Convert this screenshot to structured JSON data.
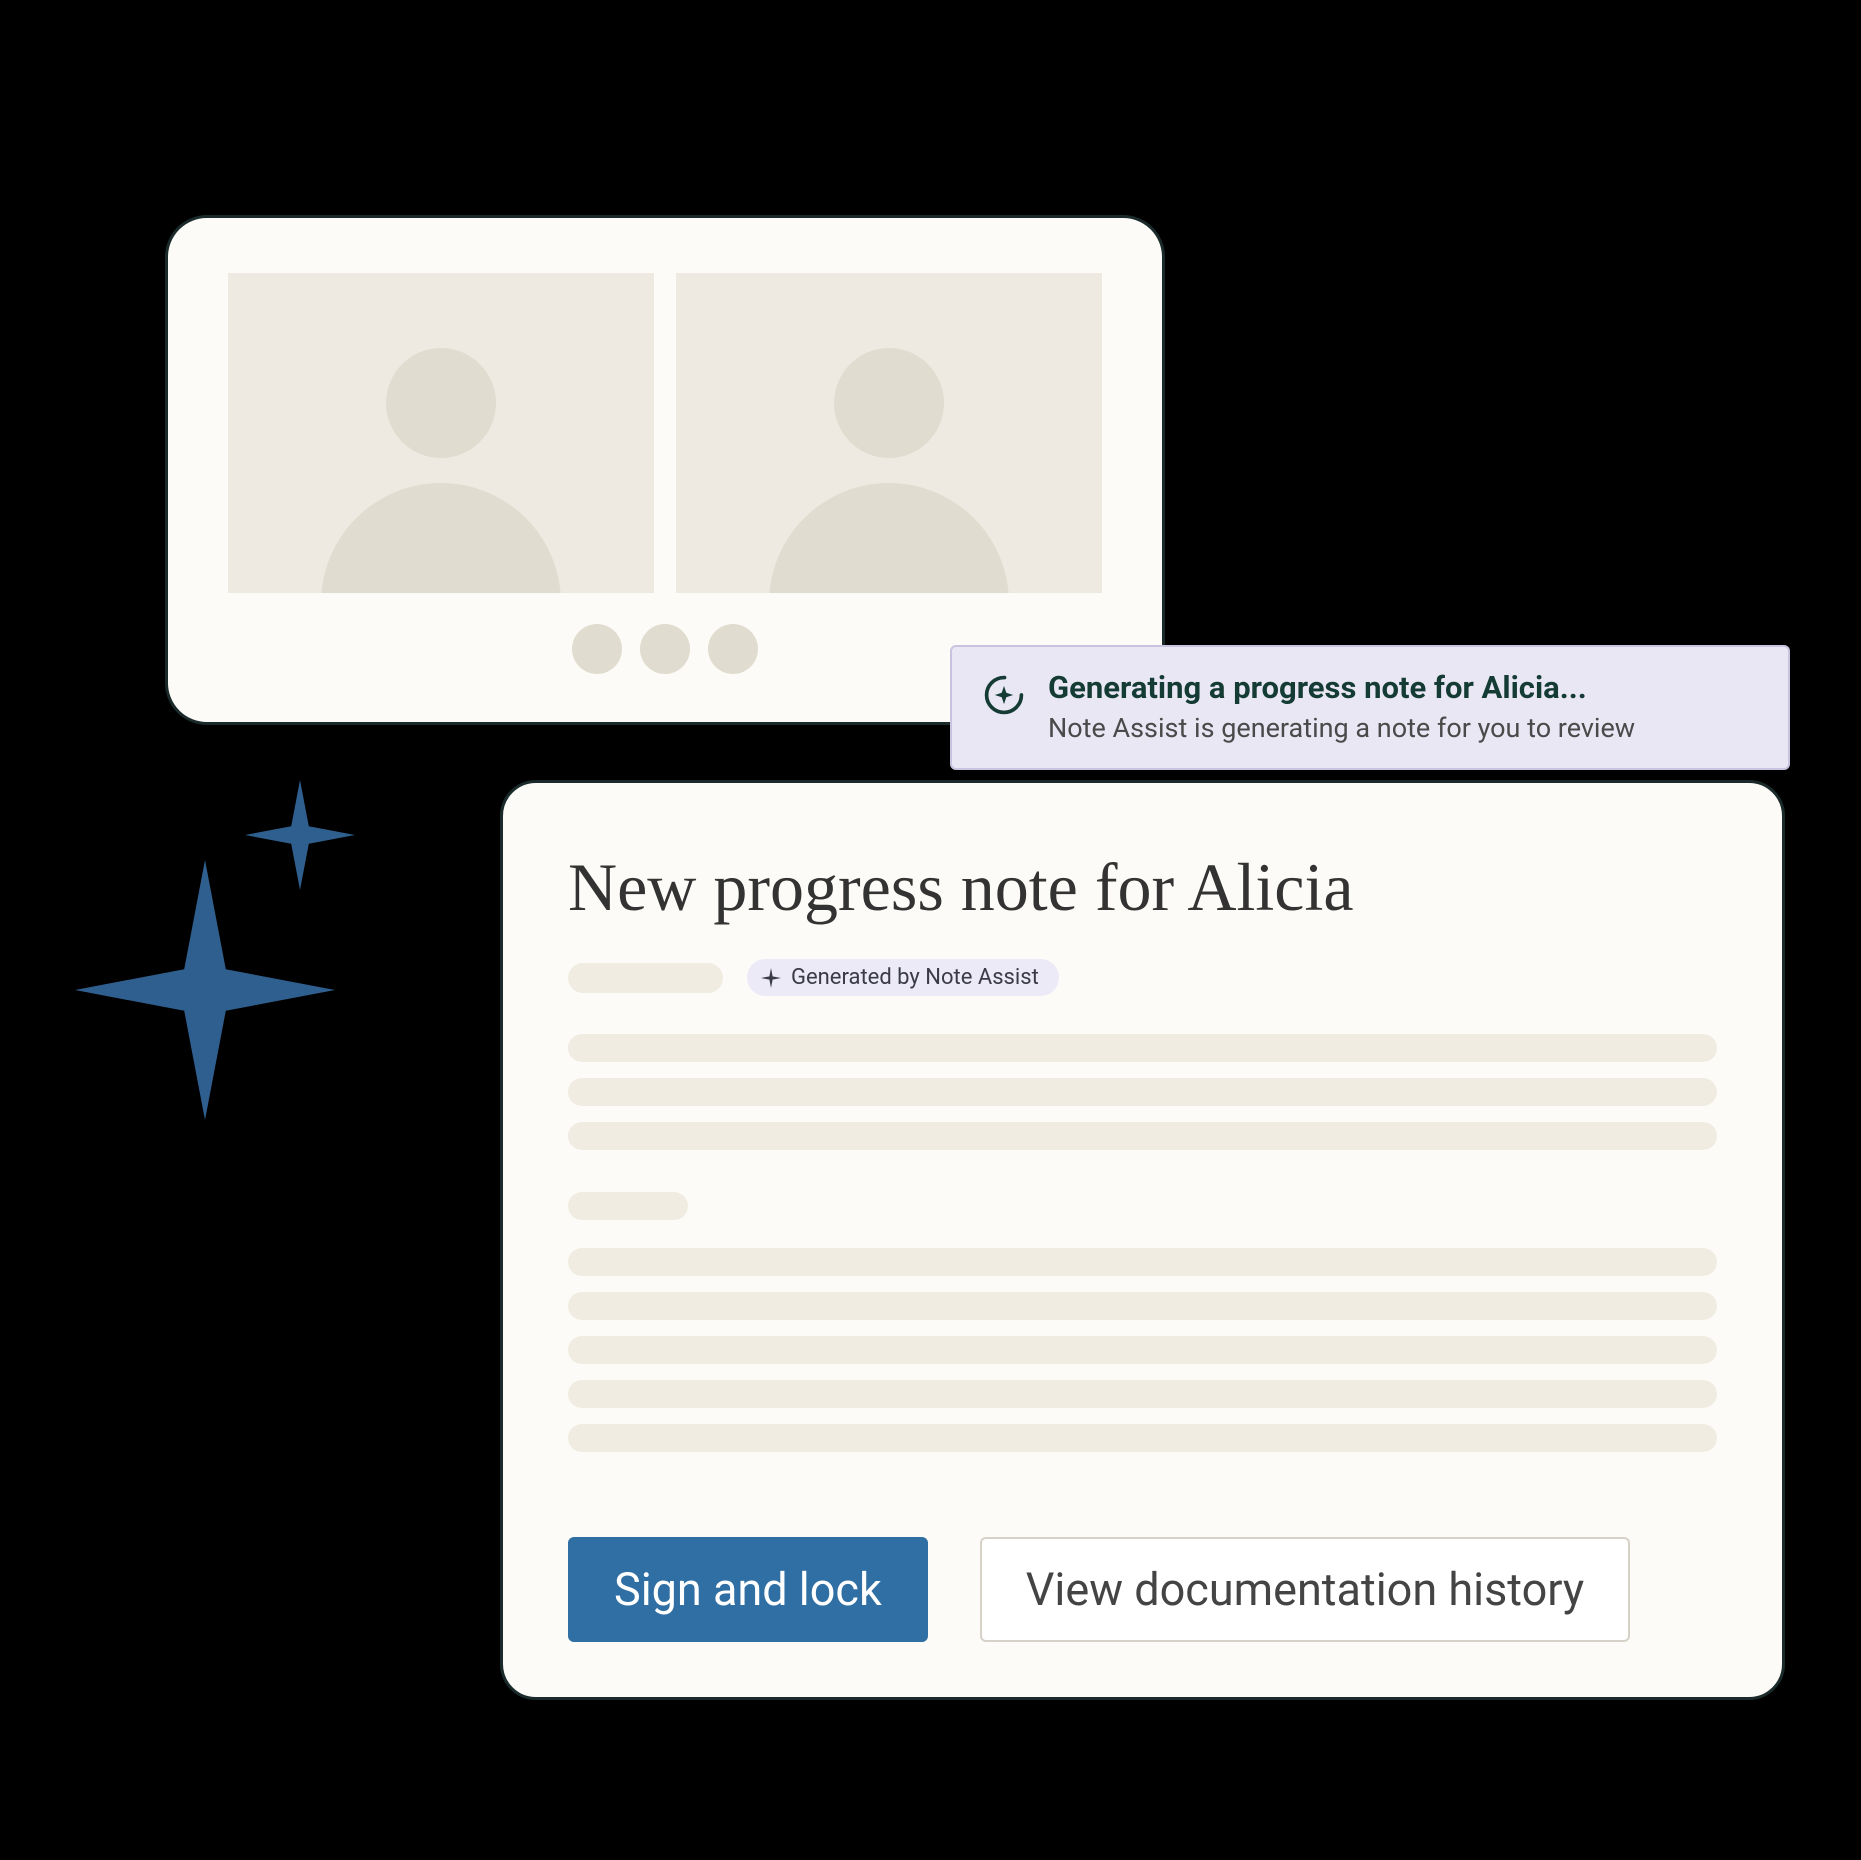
{
  "toast": {
    "title": "Generating a progress note for Alicia...",
    "subtitle": "Note Assist is generating a note for you to review"
  },
  "note": {
    "title": "New progress note for Alicia",
    "generated_badge": "Generated by Note Assist"
  },
  "buttons": {
    "primary": "Sign and lock",
    "secondary": "View documentation history"
  }
}
